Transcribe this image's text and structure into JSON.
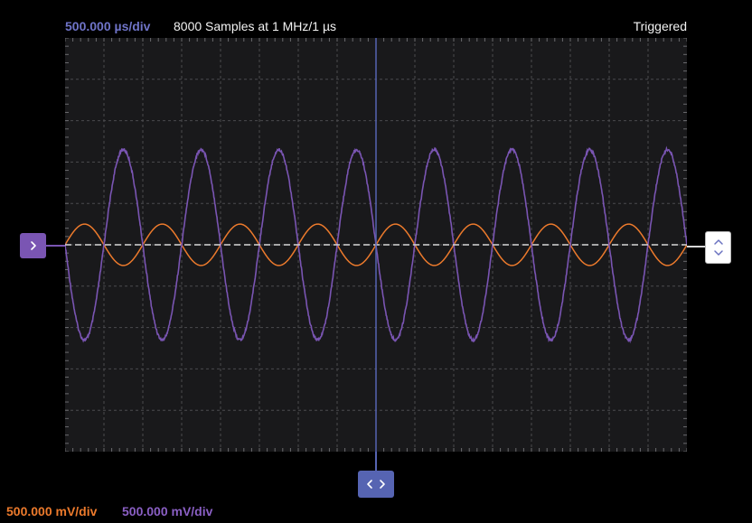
{
  "header": {
    "timebase": "500.000 µs/div",
    "sample_info": "8000 Samples at 1 MHz/1 µs",
    "trigger_status": "Triggered"
  },
  "footer": {
    "ch1_scale": "500.000 mV/div",
    "ch2_scale": "500.000 mV/div"
  },
  "colors": {
    "background": "#000000",
    "plot_background": "#19191b",
    "grid": "#4a4a4e",
    "timebase_text": "#6f74c8",
    "ch1": "#ec7a2c",
    "ch2": "#7a55b3",
    "time_cursor": "#5664b2",
    "trigger_level": "#d8d8d8"
  },
  "icons": {
    "channel_handle": "chevron-right-icon",
    "trigger_level_handle": "chevron-up-down-icon",
    "time_handle": "chevron-left-right-icon"
  },
  "chart_data": {
    "type": "line",
    "grid": true,
    "divisions": {
      "x": 16,
      "y": 10
    },
    "series": [
      {
        "channel": "ch1",
        "color": "#ec7a2c",
        "amplitude_div": 0.5,
        "cycles": 8,
        "phase_deg": 0
      },
      {
        "channel": "ch2",
        "color": "#7a55b3",
        "amplitude_div": 2.3,
        "cycles": 8,
        "phase_deg": 180
      }
    ],
    "trigger_level_div": 0,
    "time_cursor_div": 8
  }
}
